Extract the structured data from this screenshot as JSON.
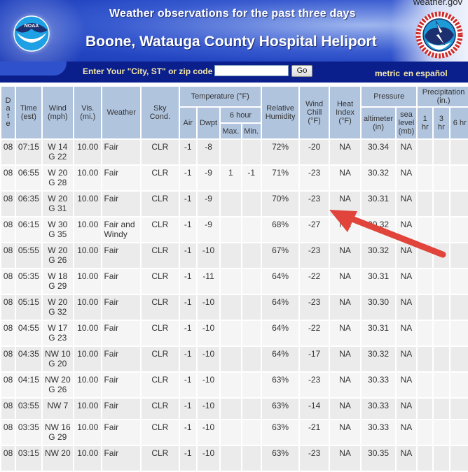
{
  "header": {
    "subtitle": "Weather observations for the past three days",
    "station_title": "Boone, Watauga County Hospital Heliport",
    "site_link": "weather.gov",
    "noaa_logo_text": "NOAA",
    "nws_logo_text": "NATIONAL WEATHER SERVICE"
  },
  "search": {
    "label": "Enter Your \"City, ST\" or zip code",
    "input_value": "",
    "input_placeholder": "",
    "go_label": "Go",
    "links": [
      "metric",
      "en español"
    ]
  },
  "table": {
    "headers": {
      "date": "D a t e",
      "time": [
        "Time",
        "(est)"
      ],
      "wind": [
        "Wind",
        "(mph)"
      ],
      "vis": [
        "Vis.",
        "(mi.)"
      ],
      "weather": "Weather",
      "sky": [
        "Sky",
        "Cond."
      ],
      "temperature": "Temperature (°F)",
      "air": "Air",
      "dwpt": "Dwpt",
      "six_hour": "6 hour",
      "max": "Max.",
      "min": "Min.",
      "rh": [
        "Relative",
        "Humidity"
      ],
      "wind_chill": [
        "Wind",
        "Chill",
        "(°F)"
      ],
      "heat_index": [
        "Heat",
        "Index",
        "(°F)"
      ],
      "pressure": "Pressure",
      "altimeter": [
        "altimeter",
        "(in)"
      ],
      "sea_level": [
        "sea",
        "level",
        "(mb)"
      ],
      "precipitation": [
        "Precipitation",
        "(in.)"
      ],
      "p1": [
        "1",
        "hr"
      ],
      "p3": [
        "3",
        "hr"
      ],
      "p6": "6 hr"
    },
    "rows": [
      {
        "date": "08",
        "time": "07:15",
        "wind1": "W 14",
        "wind2": "G 22",
        "vis": "10.00",
        "weather": "Fair",
        "sky": "CLR",
        "air": "-1",
        "dwpt": "-8",
        "max": "",
        "min": "",
        "rh": "72%",
        "chill": "-20",
        "heat": "NA",
        "alt": "30.34",
        "sea": "NA",
        "p1": "",
        "p3": "",
        "p6": ""
      },
      {
        "date": "08",
        "time": "06:55",
        "wind1": "W 20",
        "wind2": "G 28",
        "vis": "10.00",
        "weather": "Fair",
        "sky": "CLR",
        "air": "-1",
        "dwpt": "-9",
        "max": "1",
        "min": "-1",
        "rh": "71%",
        "chill": "-23",
        "heat": "NA",
        "alt": "30.32",
        "sea": "NA",
        "p1": "",
        "p3": "",
        "p6": ""
      },
      {
        "date": "08",
        "time": "06:35",
        "wind1": "W 20",
        "wind2": "G 31",
        "vis": "10.00",
        "weather": "Fair",
        "sky": "CLR",
        "air": "-1",
        "dwpt": "-9",
        "max": "",
        "min": "",
        "rh": "70%",
        "chill": "-23",
        "heat": "NA",
        "alt": "30.31",
        "sea": "NA",
        "p1": "",
        "p3": "",
        "p6": ""
      },
      {
        "date": "08",
        "time": "06:15",
        "wind1": "W 30",
        "wind2": "G 35",
        "vis": "10.00",
        "weather": "Fair and Windy",
        "sky": "CLR",
        "air": "-1",
        "dwpt": "-9",
        "max": "",
        "min": "",
        "rh": "68%",
        "chill": "-27",
        "heat": "NA",
        "alt": "30.32",
        "sea": "NA",
        "p1": "",
        "p3": "",
        "p6": ""
      },
      {
        "date": "08",
        "time": "05:55",
        "wind1": "W 20",
        "wind2": "G 26",
        "vis": "10.00",
        "weather": "Fair",
        "sky": "CLR",
        "air": "-1",
        "dwpt": "-10",
        "max": "",
        "min": "",
        "rh": "67%",
        "chill": "-23",
        "heat": "NA",
        "alt": "30.32",
        "sea": "NA",
        "p1": "",
        "p3": "",
        "p6": ""
      },
      {
        "date": "08",
        "time": "05:35",
        "wind1": "W 18",
        "wind2": "G 29",
        "vis": "10.00",
        "weather": "Fair",
        "sky": "CLR",
        "air": "-1",
        "dwpt": "-11",
        "max": "",
        "min": "",
        "rh": "64%",
        "chill": "-22",
        "heat": "NA",
        "alt": "30.31",
        "sea": "NA",
        "p1": "",
        "p3": "",
        "p6": ""
      },
      {
        "date": "08",
        "time": "05:15",
        "wind1": "W 20",
        "wind2": "G 32",
        "vis": "10.00",
        "weather": "Fair",
        "sky": "CLR",
        "air": "-1",
        "dwpt": "-10",
        "max": "",
        "min": "",
        "rh": "64%",
        "chill": "-23",
        "heat": "NA",
        "alt": "30.30",
        "sea": "NA",
        "p1": "",
        "p3": "",
        "p6": ""
      },
      {
        "date": "08",
        "time": "04:55",
        "wind1": "W 17",
        "wind2": "G 23",
        "vis": "10.00",
        "weather": "Fair",
        "sky": "CLR",
        "air": "-1",
        "dwpt": "-10",
        "max": "",
        "min": "",
        "rh": "64%",
        "chill": "-22",
        "heat": "NA",
        "alt": "30.31",
        "sea": "NA",
        "p1": "",
        "p3": "",
        "p6": ""
      },
      {
        "date": "08",
        "time": "04:35",
        "wind1": "NW 10",
        "wind2": "G 20",
        "vis": "10.00",
        "weather": "Fair",
        "sky": "CLR",
        "air": "-1",
        "dwpt": "-10",
        "max": "",
        "min": "",
        "rh": "64%",
        "chill": "-17",
        "heat": "NA",
        "alt": "30.32",
        "sea": "NA",
        "p1": "",
        "p3": "",
        "p6": ""
      },
      {
        "date": "08",
        "time": "04:15",
        "wind1": "NW 20",
        "wind2": "G 26",
        "vis": "10.00",
        "weather": "Fair",
        "sky": "CLR",
        "air": "-1",
        "dwpt": "-10",
        "max": "",
        "min": "",
        "rh": "63%",
        "chill": "-23",
        "heat": "NA",
        "alt": "30.33",
        "sea": "NA",
        "p1": "",
        "p3": "",
        "p6": ""
      },
      {
        "date": "08",
        "time": "03:55",
        "wind1": "NW 7",
        "wind2": "",
        "vis": "10.00",
        "weather": "Fair",
        "sky": "CLR",
        "air": "-1",
        "dwpt": "-10",
        "max": "",
        "min": "",
        "rh": "63%",
        "chill": "-14",
        "heat": "NA",
        "alt": "30.33",
        "sea": "NA",
        "p1": "",
        "p3": "",
        "p6": ""
      },
      {
        "date": "08",
        "time": "03:35",
        "wind1": "NW 16",
        "wind2": "G 29",
        "vis": "10.00",
        "weather": "Fair",
        "sky": "CLR",
        "air": "-1",
        "dwpt": "-10",
        "max": "",
        "min": "",
        "rh": "63%",
        "chill": "-21",
        "heat": "NA",
        "alt": "30.33",
        "sea": "NA",
        "p1": "",
        "p3": "",
        "p6": ""
      },
      {
        "date": "08",
        "time": "03:15",
        "wind1": "NW 20",
        "wind2": "",
        "vis": "10.00",
        "weather": "Fair",
        "sky": "CLR",
        "air": "-1",
        "dwpt": "-10",
        "max": "",
        "min": "",
        "rh": "63%",
        "chill": "-23",
        "heat": "NA",
        "alt": "30.35",
        "sea": "NA",
        "p1": "",
        "p3": "",
        "p6": ""
      }
    ]
  },
  "annotation": {
    "arrow_color": "#e0443a",
    "points_to": "wind chill -27"
  },
  "colors": {
    "header_cell": "#b0c4de",
    "search_bar": "#0a1e8c",
    "link_text": "#f3e8a8"
  }
}
